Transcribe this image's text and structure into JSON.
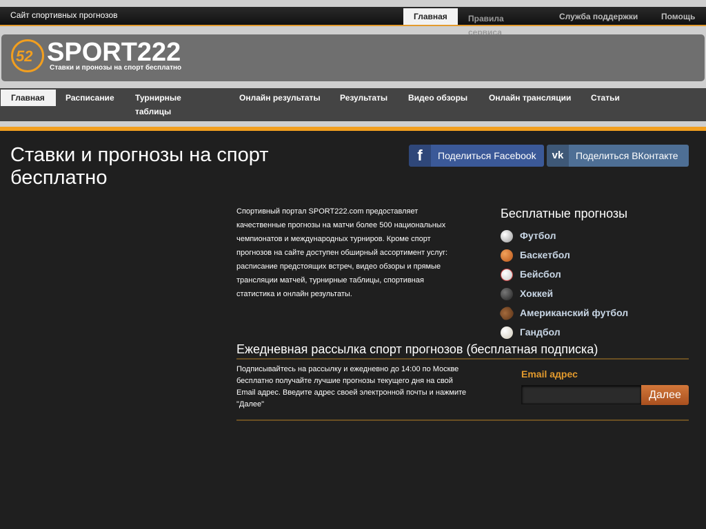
{
  "top_bar": {
    "site_title": "Сайт спортивных прогнозов",
    "nav": [
      "Главная",
      "Правила сервиса",
      "Служба поддержки",
      "Помощь"
    ]
  },
  "header": {
    "logo_mark": "52",
    "logo_text": "SPORT222",
    "tagline": "Ставки и пронозы на спорт бесплатно"
  },
  "main_nav": [
    "Главная",
    "Расписание",
    "Турнирные таблицы",
    "Онлайн результаты",
    "Результаты",
    "Видео обзоры",
    "Онлайн трансляции",
    "Статьи"
  ],
  "page": {
    "title": "Ставки и прогнозы на спорт бесплатно"
  },
  "share": {
    "facebook_label": "Поделиться Facebook",
    "facebook_icon": "f",
    "vk_label": "Поделиться ВКонтакте",
    "vk_icon": "vk"
  },
  "description": "Спортивный портал SPORT222.com предоставляет качественные прогнозы на матчи более 500 национальных чемпионатов и международных турниров. Кроме спорт прогнозов на сайте доступен обширный ассортимент услуг: расписание предстоящих встреч, видео обзоры и прямые трансляции матчей, турнирные таблицы, спортивная статистика и онлайн результаты.",
  "free_predictions": {
    "title": "Бесплатные прогнозы",
    "sports": [
      {
        "label": "Футбол",
        "icon": "soccer-ball-icon",
        "color": "#e6e6e6"
      },
      {
        "label": "Баскетбол",
        "icon": "basketball-icon",
        "color": "#d9782a"
      },
      {
        "label": "Бейсбол",
        "icon": "baseball-icon",
        "color": "#f1f1f1"
      },
      {
        "label": "Хоккей",
        "icon": "hockey-puck-icon",
        "color": "#3a3a3a"
      },
      {
        "label": "Американский футбол",
        "icon": "american-football-icon",
        "color": "#7a4a2a"
      },
      {
        "label": "Гандбол",
        "icon": "handball-icon",
        "color": "#ece9df"
      }
    ]
  },
  "newsletter": {
    "title": "Ежедневная рассылка спорт прогнозов (бесплатная подписка)",
    "text": "Подписывайтесь на рассылку и ежедневно до 14:00 по Москве бесплатно получайте лучшие прогнозы текущего дня на свой Email адрес. Введите адрес своей электронной почты и нажмите \"Далее\"",
    "email_label": "Email адрес",
    "email_value": "",
    "submit_label": "Далее"
  }
}
